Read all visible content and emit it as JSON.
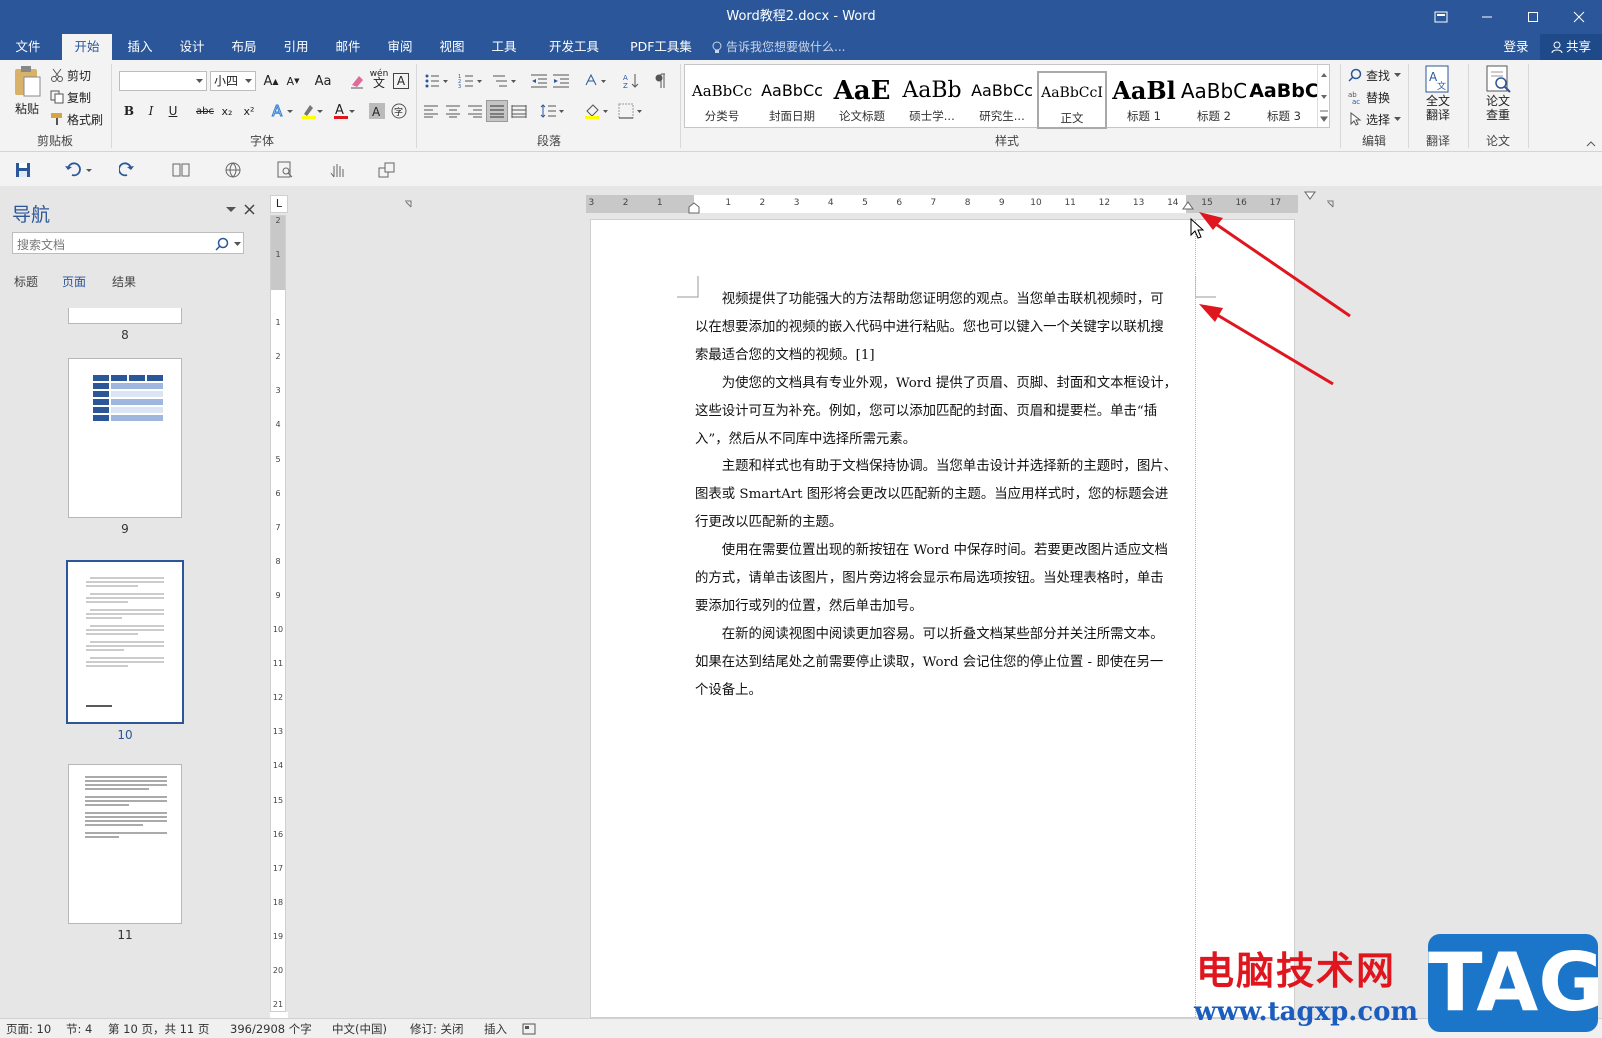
{
  "window": {
    "title": "Word教程2.docx - Word"
  },
  "tabs": [
    "文件",
    "开始",
    "插入",
    "设计",
    "布局",
    "引用",
    "邮件",
    "审阅",
    "视图",
    "工具",
    "开发工具",
    "PDF工具集"
  ],
  "tell_me": "告诉我您想要做什么...",
  "account": {
    "login": "登录",
    "share": "共享"
  },
  "ribbon": {
    "clipboard": {
      "paste": "粘贴",
      "cut": "剪切",
      "copy": "复制",
      "format_painter": "格式刷",
      "group": "剪贴板"
    },
    "font": {
      "font_name": "",
      "font_size": "小四",
      "group": "字体",
      "aa_label": "Aa",
      "bold": "B",
      "italic": "I",
      "underline": "U",
      "strike": "abc",
      "sub": "x₂",
      "sup": "x²",
      "wen": "wén",
      "char_a": "A"
    },
    "paragraph": {
      "group": "段落"
    },
    "styles": {
      "group": "样式",
      "items": [
        {
          "preview": "AaBbCc",
          "name": "分类号"
        },
        {
          "preview": "AaBbCc",
          "name": "封面日期"
        },
        {
          "preview": "AaE",
          "name": "论文标题"
        },
        {
          "preview": "AaBb",
          "name": "硕士学..."
        },
        {
          "preview": "AaBbCc",
          "name": "研究生..."
        },
        {
          "preview": "AaBbCcI",
          "name": "正文"
        },
        {
          "preview": "AaBl",
          "name": "标题 1"
        },
        {
          "preview": "AaBbC",
          "name": "标题 2"
        },
        {
          "preview": "AaBbC",
          "name": "标题 3"
        }
      ]
    },
    "editing": {
      "find": "查找",
      "replace": "替换",
      "select": "选择",
      "group": "编辑"
    },
    "translate": {
      "label1": "全文",
      "label2": "翻译",
      "group": "翻译"
    },
    "paper": {
      "label1": "论文",
      "label2": "查重",
      "group": "论文"
    }
  },
  "nav": {
    "title": "导航",
    "search_placeholder": "搜索文档",
    "tabs": [
      "标题",
      "页面",
      "结果"
    ],
    "pages": [
      "8",
      "9",
      "10",
      "11"
    ]
  },
  "ruler": {
    "h_ticks": [
      "3",
      "2",
      "1",
      "1",
      "2",
      "3",
      "4",
      "5",
      "6",
      "7",
      "8",
      "9",
      "10",
      "11",
      "12",
      "13",
      "14",
      "15",
      "16",
      "17"
    ],
    "v_ticks": [
      "2",
      "1",
      "1",
      "2",
      "3",
      "4",
      "5",
      "6",
      "7",
      "8",
      "9",
      "10",
      "11",
      "12",
      "13",
      "14",
      "15",
      "16",
      "17",
      "18",
      "19",
      "20",
      "21"
    ],
    "corner": "L"
  },
  "document": {
    "paragraphs": [
      [
        "　　视频提供了功能强大的方法帮助您证明您的观点。当您单击联机视频时，可",
        "以在想要添加的视频的嵌入代码中进行粘贴。您也可以键入一个关键字以联机搜",
        "索最适合您的文档的视频。[1]"
      ],
      [
        "　　为使您的文档具有专业外观，Word 提供了页眉、页脚、封面和文本框设计，",
        "这些设计可互为补充。例如，您可以添加匹配的封面、页眉和提要栏。单击“插",
        "入”，然后从不同库中选择所需元素。"
      ],
      [
        "　　主题和样式也有助于文档保持协调。当您单击设计并选择新的主题时，图片、",
        "图表或 SmartArt 图形将会更改以匹配新的主题。当应用样式时，您的标题会进",
        "行更改以匹配新的主题。"
      ],
      [
        "　　使用在需要位置出现的新按钮在 Word 中保存时间。若要更改图片适应文档",
        "的方式，请单击该图片，图片旁边将会显示布局选项按钮。当处理表格时，单击",
        "要添加行或列的位置，然后单击加号。"
      ],
      [
        "　　在新的阅读视图中阅读更加容易。可以折叠文档某些部分并关注所需文本。",
        "如果在达到结尾处之前需要停止读取，Word 会记住您的停止位置 - 即使在另一",
        "个设备上。"
      ]
    ]
  },
  "status": {
    "page": "页面: 10",
    "section": "节: 4",
    "page_of": "第 10 页，共 11 页",
    "words": "396/2908 个字",
    "language": "中文(中国)",
    "track": "修订: 关闭",
    "insert": "插入"
  },
  "watermark": {
    "text": "电脑技术网",
    "url": "www.tagxp.com",
    "tag": "TAG"
  },
  "colors": {
    "brand": "#2b579a",
    "arrow": "#e0161e",
    "watermark_blue": "#1b75c9"
  }
}
